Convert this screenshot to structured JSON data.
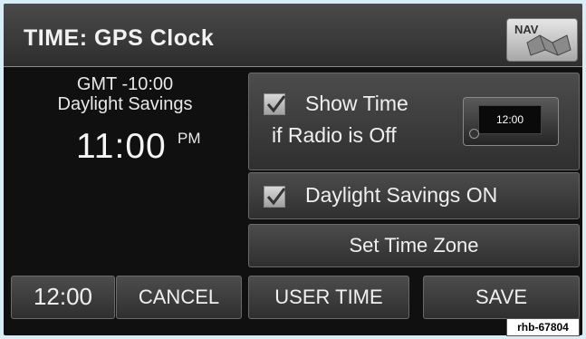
{
  "header": {
    "title": "TIME: GPS Clock",
    "nav_button_label": "NAV",
    "nav_icon": "map-icon"
  },
  "time_info": {
    "timezone": "GMT -10:00",
    "daylight_status": "Daylight Savings",
    "time": "11:00",
    "ampm": "PM"
  },
  "options": {
    "show_time": {
      "line1": "Show Time",
      "line2": "if Radio is Off",
      "checked": true,
      "radio_display": "12:00"
    },
    "daylight_savings": {
      "label": "Daylight Savings ON",
      "checked": true
    },
    "set_time_zone_label": "Set Time Zone"
  },
  "footer": {
    "clock_format_label": "12:00",
    "cancel_label": "CANCEL",
    "user_time_label": "USER TIME",
    "save_label": "SAVE"
  },
  "image_tag": "rhb-67804",
  "colors": {
    "screen_bg": "#101010",
    "button_bg": "#3c3c3c",
    "text": "#f0f0f0",
    "outer_bg": "#d7eef6"
  }
}
